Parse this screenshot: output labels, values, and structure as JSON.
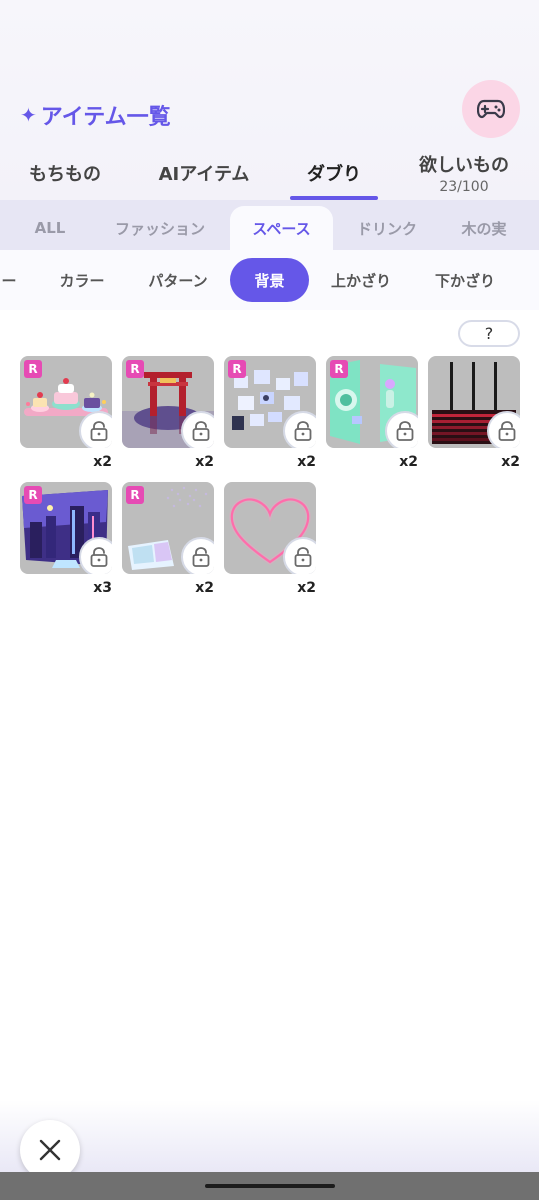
{
  "header": {
    "title_icon": "sparkle-icon",
    "title_glyph": "✦",
    "title": "アイテム一覧",
    "game_button_icon": "gamepad-icon",
    "accent_color": "#6557e8",
    "game_button_bg": "#fbd6e6"
  },
  "main_tabs": [
    {
      "label": "もちもの",
      "active": false
    },
    {
      "label": "AIアイテム",
      "active": false
    },
    {
      "label": "ダブり",
      "active": true
    },
    {
      "label": "欲しいもの",
      "count": "23/100",
      "active": false
    }
  ],
  "category_tabs": [
    {
      "label": "ALL",
      "active": false
    },
    {
      "label": "ファッション",
      "active": false
    },
    {
      "label": "スペース",
      "active": true
    },
    {
      "label": "ドリンク",
      "active": false
    },
    {
      "label": "木の実",
      "active": false
    }
  ],
  "sub_tabs": [
    {
      "label": "ー",
      "active": false
    },
    {
      "label": "カラー",
      "active": false
    },
    {
      "label": "パターン",
      "active": false
    },
    {
      "label": "背景",
      "active": true
    },
    {
      "label": "上かざり",
      "active": false
    },
    {
      "label": "下かざり",
      "active": false
    }
  ],
  "help_button": {
    "label": "?"
  },
  "items": [
    {
      "rare": "R",
      "qty": "x2",
      "art": "cake-scene",
      "locked": true
    },
    {
      "rare": "R",
      "qty": "x2",
      "art": "red-gate",
      "locked": true
    },
    {
      "rare": "R",
      "qty": "x2",
      "art": "photo-frames",
      "locked": true
    },
    {
      "rare": "R",
      "qty": "x2",
      "art": "mint-panels",
      "locked": true
    },
    {
      "rare": "",
      "qty": "x2",
      "art": "dark-stage",
      "locked": true
    },
    {
      "rare": "R",
      "qty": "x3",
      "art": "night-city",
      "locked": true
    },
    {
      "rare": "R",
      "qty": "x2",
      "art": "glitter-ice",
      "locked": true
    },
    {
      "rare": "",
      "qty": "x2",
      "art": "neon-heart",
      "locked": true
    }
  ],
  "footer": {
    "close_icon": "close-icon"
  }
}
